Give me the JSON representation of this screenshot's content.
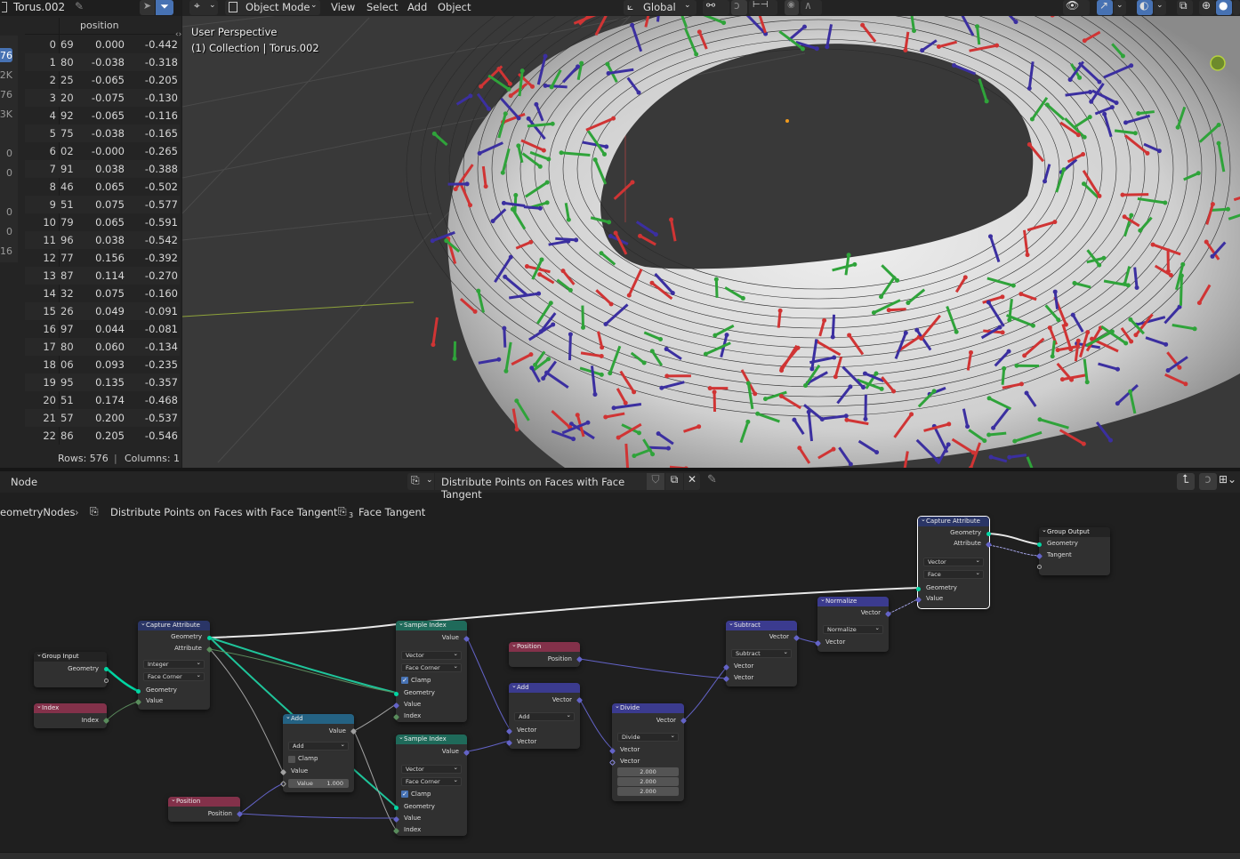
{
  "spreadsheet": {
    "object_name": "Torus.002",
    "column_header": "position",
    "side_values": [
      "76",
      "2K",
      "76",
      "3K",
      "0",
      "0",
      "0",
      "0",
      "16"
    ],
    "rows": [
      {
        "idx": "0",
        "id": "69",
        "x": "0.000",
        "y": "-0.442"
      },
      {
        "idx": "1",
        "id": "80",
        "x": "-0.038",
        "y": "-0.318"
      },
      {
        "idx": "2",
        "id": "25",
        "x": "-0.065",
        "y": "-0.205"
      },
      {
        "idx": "3",
        "id": "20",
        "x": "-0.075",
        "y": "-0.130"
      },
      {
        "idx": "4",
        "id": "92",
        "x": "-0.065",
        "y": "-0.116"
      },
      {
        "idx": "5",
        "id": "75",
        "x": "-0.038",
        "y": "-0.165"
      },
      {
        "idx": "6",
        "id": "02",
        "x": "-0.000",
        "y": "-0.265"
      },
      {
        "idx": "7",
        "id": "91",
        "x": "0.038",
        "y": "-0.388"
      },
      {
        "idx": "8",
        "id": "46",
        "x": "0.065",
        "y": "-0.502"
      },
      {
        "idx": "9",
        "id": "51",
        "x": "0.075",
        "y": "-0.577"
      },
      {
        "idx": "10",
        "id": "79",
        "x": "0.065",
        "y": "-0.591"
      },
      {
        "idx": "11",
        "id": "96",
        "x": "0.038",
        "y": "-0.542"
      },
      {
        "idx": "12",
        "id": "77",
        "x": "0.156",
        "y": "-0.392"
      },
      {
        "idx": "13",
        "id": "87",
        "x": "0.114",
        "y": "-0.270"
      },
      {
        "idx": "14",
        "id": "32",
        "x": "0.075",
        "y": "-0.160"
      },
      {
        "idx": "15",
        "id": "26",
        "x": "0.049",
        "y": "-0.091"
      },
      {
        "idx": "16",
        "id": "97",
        "x": "0.044",
        "y": "-0.081"
      },
      {
        "idx": "17",
        "id": "80",
        "x": "0.060",
        "y": "-0.134"
      },
      {
        "idx": "18",
        "id": "06",
        "x": "0.093",
        "y": "-0.235"
      },
      {
        "idx": "19",
        "id": "95",
        "x": "0.135",
        "y": "-0.357"
      },
      {
        "idx": "20",
        "id": "51",
        "x": "0.174",
        "y": "-0.468"
      },
      {
        "idx": "21",
        "id": "57",
        "x": "0.200",
        "y": "-0.537"
      },
      {
        "idx": "22",
        "id": "86",
        "x": "0.205",
        "y": "-0.546"
      }
    ],
    "footer": {
      "rows_label": "Rows: 576",
      "sep": "|",
      "columns_label": "Columns: 1"
    }
  },
  "viewport": {
    "header": {
      "mode": "Object Mode",
      "menus": [
        "View",
        "Select",
        "Add",
        "Object"
      ],
      "orientation": "Global"
    },
    "overlay": {
      "view_name": "User Perspective",
      "collection": "(1) Collection | Torus.002"
    },
    "colors": {
      "tangent": "#d03434",
      "bitangent": "#2fa33a",
      "normal": "#3b2fa0",
      "mesh": "#d8d8d8",
      "bg": "#393939"
    }
  },
  "node_editor": {
    "header": {
      "menu": "Node",
      "tree_name": "Distribute Points on Faces with Face Tangent"
    },
    "breadcrumb": [
      "eometryNodes",
      "Distribute Points on Faces with Face Tangent",
      "Face Tangent"
    ],
    "breadcrumb_sub": "3",
    "nodes": {
      "group_input": {
        "title": "Group Input",
        "out": [
          "Geometry"
        ]
      },
      "index": {
        "title": "Index",
        "out": [
          "Index"
        ]
      },
      "capture1": {
        "title": "Capture Attribute",
        "out": [
          "Geometry",
          "Attribute"
        ],
        "dd1": "Integer",
        "dd2": "Face Corner",
        "in": [
          "Geometry",
          "Value"
        ]
      },
      "position1": {
        "title": "Position",
        "out": [
          "Position"
        ]
      },
      "add_math": {
        "title": "Add",
        "out": [
          "Value"
        ],
        "dd": "Add",
        "clamp": "Clamp",
        "in": [
          "Value"
        ],
        "field_label": "Value",
        "field_value": "1.000"
      },
      "sample1": {
        "title": "Sample Index",
        "out": [
          "Value"
        ],
        "dd1": "Vector",
        "dd2": "Face Corner",
        "clamp": "Clamp",
        "in": [
          "Geometry",
          "Value",
          "Index"
        ]
      },
      "sample2": {
        "title": "Sample Index",
        "out": [
          "Value"
        ],
        "dd1": "Vector",
        "dd2": "Face Corner",
        "clamp": "Clamp",
        "in": [
          "Geometry",
          "Value",
          "Index"
        ]
      },
      "position2": {
        "title": "Position",
        "out": [
          "Position"
        ]
      },
      "add_vec": {
        "title": "Add",
        "out": [
          "Vector"
        ],
        "dd": "Add",
        "in": [
          "Vector",
          "Vector"
        ]
      },
      "divide": {
        "title": "Divide",
        "out": [
          "Vector"
        ],
        "dd": "Divide",
        "in": [
          "Vector",
          "Vector"
        ],
        "values": [
          "2.000",
          "2.000",
          "2.000"
        ]
      },
      "subtract": {
        "title": "Subtract",
        "out": [
          "Vector"
        ],
        "dd": "Subtract",
        "in": [
          "Vector",
          "Vector"
        ]
      },
      "normalize": {
        "title": "Normalize",
        "out": [
          "Vector"
        ],
        "dd": "Normalize",
        "in": [
          "Vector"
        ]
      },
      "capture2": {
        "title": "Capture Attribute",
        "out": [
          "Geometry",
          "Attribute"
        ],
        "dd1": "Vector",
        "dd2": "Face",
        "in": [
          "Geometry",
          "Value"
        ]
      },
      "group_output": {
        "title": "Group Output",
        "in": [
          "Geometry",
          "Tangent"
        ]
      }
    }
  }
}
